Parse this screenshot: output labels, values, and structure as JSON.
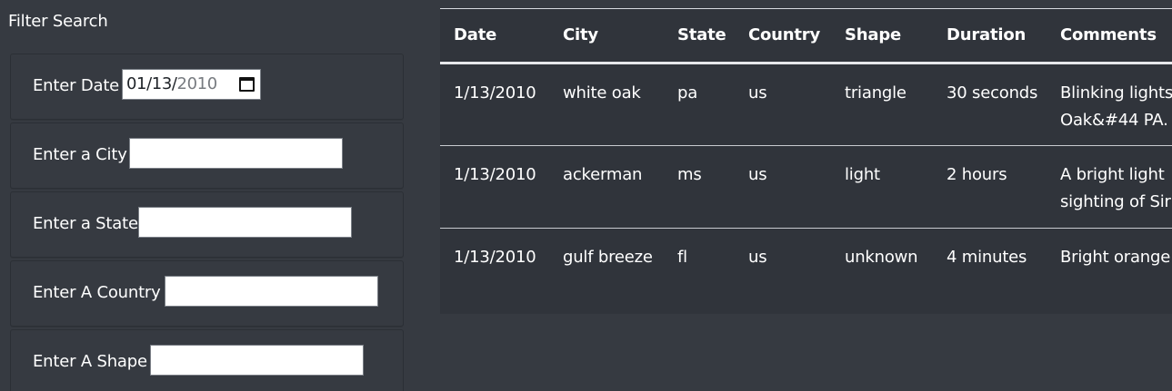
{
  "filters": {
    "title": "Filter Search",
    "date": {
      "label": "Enter Date",
      "month_day": "01/13/",
      "year": "2010"
    },
    "city": {
      "label": "Enter a City",
      "value": ""
    },
    "state": {
      "label": "Enter a State",
      "value": ""
    },
    "country": {
      "label": "Enter A Country",
      "value": ""
    },
    "shape": {
      "label": "Enter A Shape",
      "value": ""
    }
  },
  "table": {
    "headers": [
      "Date",
      "City",
      "State",
      "Country",
      "Shape",
      "Duration",
      "Comments"
    ],
    "rows": [
      {
        "date": "1/13/2010",
        "city": "white oak",
        "state": "pa",
        "country": "us",
        "shape": "triangle",
        "duration": "30 seconds",
        "comments_line1": "Blinking lights",
        "comments_line2": "Oak&#44 PA."
      },
      {
        "date": "1/13/2010",
        "city": "ackerman",
        "state": "ms",
        "country": "us",
        "shape": "light",
        "duration": "2 hours",
        "comments_line1": "A bright light",
        "comments_line2": "sighting of Sir"
      },
      {
        "date": "1/13/2010",
        "city": "gulf breeze",
        "state": "fl",
        "country": "us",
        "shape": "unknown",
        "duration": "4 minutes",
        "comments_line1": "Bright orange",
        "comments_line2": ""
      }
    ]
  },
  "icons": {
    "date_picker": "calendar-icon"
  }
}
